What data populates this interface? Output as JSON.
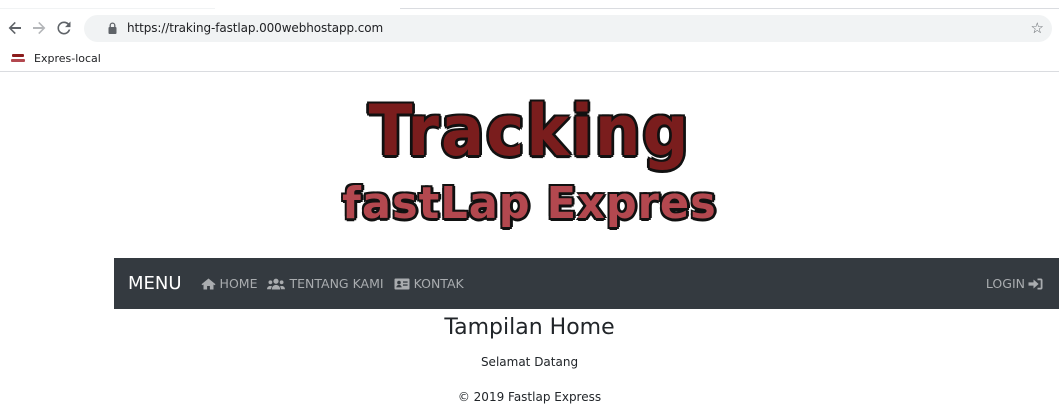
{
  "browser": {
    "url": "https://traking-fastlap.000webhostapp.com",
    "bookmarks": [
      {
        "label": "Expres-local"
      }
    ]
  },
  "logo": {
    "line1": "Tracking",
    "line2": "fastLap Expres",
    "colors": {
      "line1": "#7a1d1d",
      "line2": "#b3484f",
      "outline": "#111111"
    }
  },
  "navbar": {
    "brand": "MENU",
    "items": [
      {
        "label": "HOME",
        "icon": "home-icon"
      },
      {
        "label": "TENTANG KAMI",
        "icon": "users-icon"
      },
      {
        "label": "KONTAK",
        "icon": "address-card-icon"
      }
    ],
    "login": {
      "label": "LOGIN",
      "icon": "sign-in-icon"
    },
    "background": "#343a40"
  },
  "main": {
    "title": "Tampilan Home",
    "subtitle": "Selamat Datang"
  },
  "footer": {
    "text": "© 2019 Fastlap Express"
  }
}
